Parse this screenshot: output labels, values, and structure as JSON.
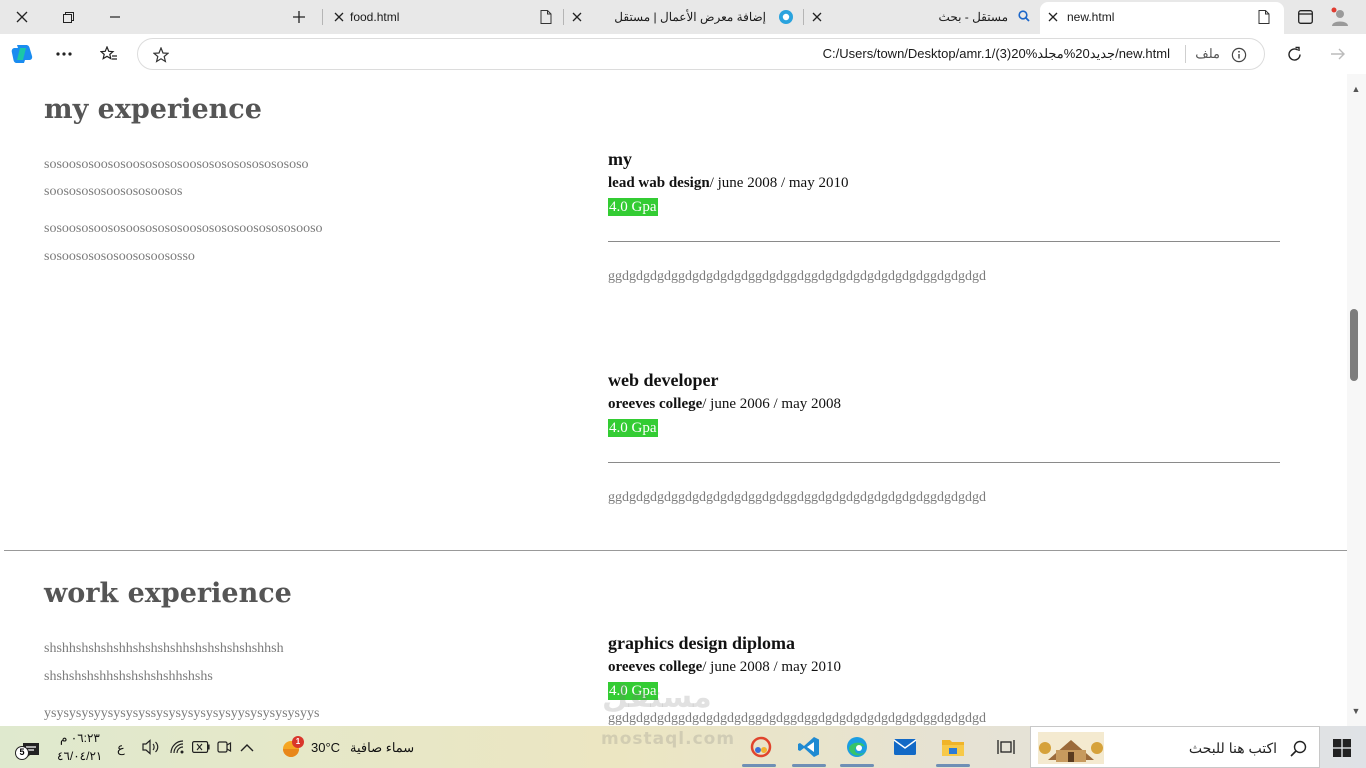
{
  "browser": {
    "tabs": [
      {
        "title": "food.html",
        "active": false
      },
      {
        "title": "إضافة معرض الأعمال | مستقل",
        "active": false
      },
      {
        "title": "مستقل - بحث",
        "active": false
      },
      {
        "title": "new.html",
        "active": true
      }
    ],
    "address": {
      "url": "C:/Users/town/Desktop/amr.1/(3)20%جديد20%مجلد/new.html",
      "file_label": "ملف"
    }
  },
  "page": {
    "section1": {
      "heading": "my experience",
      "left_lines": [
        "sosoososoososoososososoosososososososososo",
        "soososososoosososoosos",
        "sosoososoososoososososoososososoososososooso",
        "sosoososososoososoosossо"
      ],
      "entries": [
        {
          "title": "my",
          "org": "lead wab design",
          "dates": "/ june 2008 / may 2010",
          "badge": "4.0 Gpa",
          "text": "ggdgdgdgdggdgdgdgdgdggdgdggdggdgdgdgdgdgdgdgdggdgdgdgd"
        },
        {
          "title": "web developer",
          "org": "oreeves college",
          "dates": "/ june 2006 / may 2008",
          "badge": "4.0 Gpa",
          "text": "ggdgdgdgdggdgdgdgdgdggdgdggdggdgdgdgdgdgdgdgdggdgdgdgd"
        }
      ]
    },
    "section2": {
      "heading": "work experience",
      "left_lines": [
        "shshhshshshshhshshshshhshshshshshshhsh",
        "shshshshshhshshshshshhshshs",
        "ysysysysyysysysyssysysysysysysyysysysysysyys"
      ],
      "entries": [
        {
          "title": "graphics design diploma",
          "org": "oreeves college",
          "dates": "/ june 2008 / may 2010",
          "badge": "4.0 Gpa",
          "text": "ggdgdgdgdggdgdgdgdgdggdgdggdggdgdgdgdgdgdgdgdggdgdgdgd"
        }
      ]
    },
    "watermark": {
      "line1": "مستقل",
      "line2": "mostaql.com"
    }
  },
  "taskbar": {
    "search_placeholder": "اكتب هنا للبحث",
    "weather_temp": "30°C",
    "weather_desc": "سماء صافية",
    "weather_badge": "1",
    "time": "٠٦:٢٣ م",
    "date": "٤٦/٠٤/٢١",
    "lang": "ع",
    "notification_count": "5"
  },
  "colors": {
    "gpa_badge": "#33cc33",
    "heading": "#555555",
    "muted_text": "#7b7b7b"
  }
}
